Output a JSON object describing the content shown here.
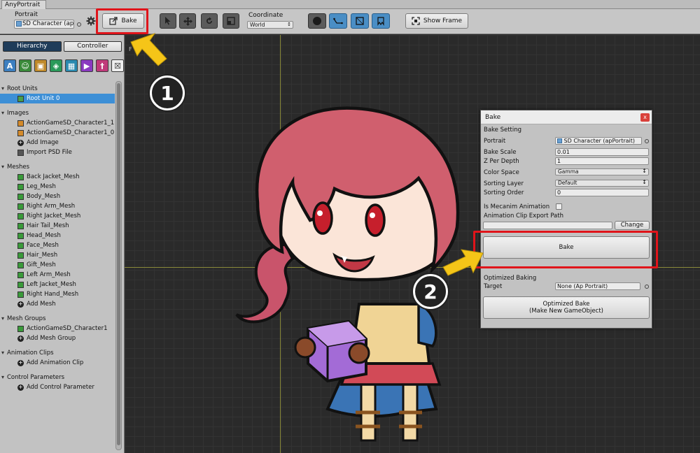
{
  "window": {
    "title": "AnyPortrait"
  },
  "toolbar": {
    "portrait_label": "Portrait",
    "portrait_value": "SD Character (ap",
    "bake_label": "Bake",
    "coordinate_label": "Coordinate",
    "coordinate_value": "World",
    "show_frame_label": "Show Frame"
  },
  "sidebar": {
    "tabs": [
      "Hierarchy",
      "Controller"
    ],
    "icons": [
      "text-icon",
      "character-icon",
      "image-icon",
      "mesh-icon",
      "mesh-group-icon",
      "animation-icon",
      "control-param-icon",
      "close-box-icon"
    ],
    "tree": [
      {
        "type": "cat",
        "label": "Root Units"
      },
      {
        "type": "item",
        "label": "Root Unit 0",
        "icon": "root-unit",
        "selected": true
      },
      {
        "type": "gap"
      },
      {
        "type": "cat",
        "label": "Images"
      },
      {
        "type": "item",
        "label": "ActionGameSD_Character1_1",
        "icon": "image"
      },
      {
        "type": "item",
        "label": "ActionGameSD_Character1_0",
        "icon": "image"
      },
      {
        "type": "item",
        "label": "Add Image",
        "icon": "add"
      },
      {
        "type": "item",
        "label": "Import PSD File",
        "icon": "import"
      },
      {
        "type": "gap"
      },
      {
        "type": "cat",
        "label": "Meshes"
      },
      {
        "type": "item",
        "label": "Back Jacket_Mesh",
        "icon": "mesh"
      },
      {
        "type": "item",
        "label": "Leg_Mesh",
        "icon": "mesh"
      },
      {
        "type": "item",
        "label": "Body_Mesh",
        "icon": "mesh"
      },
      {
        "type": "item",
        "label": "Right Arm_Mesh",
        "icon": "mesh"
      },
      {
        "type": "item",
        "label": "Right Jacket_Mesh",
        "icon": "mesh"
      },
      {
        "type": "item",
        "label": "Hair Tail_Mesh",
        "icon": "mesh"
      },
      {
        "type": "item",
        "label": "Head_Mesh",
        "icon": "mesh"
      },
      {
        "type": "item",
        "label": "Face_Mesh",
        "icon": "mesh"
      },
      {
        "type": "item",
        "label": "Hair_Mesh",
        "icon": "mesh"
      },
      {
        "type": "item",
        "label": "Gift_Mesh",
        "icon": "mesh"
      },
      {
        "type": "item",
        "label": "Left Arm_Mesh",
        "icon": "mesh"
      },
      {
        "type": "item",
        "label": "Left Jacket_Mesh",
        "icon": "mesh"
      },
      {
        "type": "item",
        "label": "Right Hand_Mesh",
        "icon": "mesh"
      },
      {
        "type": "item",
        "label": "Add Mesh",
        "icon": "add"
      },
      {
        "type": "gap"
      },
      {
        "type": "cat",
        "label": "Mesh Groups"
      },
      {
        "type": "item",
        "label": "ActionGameSD_Character1",
        "icon": "mesh"
      },
      {
        "type": "item",
        "label": "Add Mesh Group",
        "icon": "add"
      },
      {
        "type": "gap"
      },
      {
        "type": "cat",
        "label": "Animation Clips"
      },
      {
        "type": "item",
        "label": "Add Animation Clip",
        "icon": "add"
      },
      {
        "type": "gap"
      },
      {
        "type": "cat",
        "label": "Control Parameters"
      },
      {
        "type": "item",
        "label": "Add Control Parameter",
        "icon": "add"
      }
    ]
  },
  "bake_dialog": {
    "title": "Bake",
    "close": "x",
    "section": "Bake Setting",
    "portrait_label": "Portrait",
    "portrait_value": "SD Character (apPortrait)",
    "bake_scale_label": "Bake Scale",
    "bake_scale_value": "0.01",
    "z_per_depth_label": "Z Per Depth",
    "z_per_depth_value": "1",
    "color_space_label": "Color Space",
    "color_space_value": "Gamma",
    "sorting_layer_label": "Sorting Layer",
    "sorting_layer_value": "Default",
    "sorting_order_label": "Sorting Order",
    "sorting_order_value": "0",
    "mecanim_label": "Is Mecanim Animation",
    "export_path_label": "Animation Clip Export Path",
    "export_path_value": "",
    "change_label": "Change",
    "bake_button": "Bake",
    "optimized_section": "Optimized Baking",
    "target_label": "Target",
    "target_value": "None (Ap Portrait)",
    "optimized_button_line1": "Optimized Bake",
    "optimized_button_line2": "(Make New GameObject)"
  },
  "annotations": {
    "step1": "1",
    "step2": "2",
    "highlight_color": "#e0141a",
    "arrow_color": "#f5c518"
  }
}
